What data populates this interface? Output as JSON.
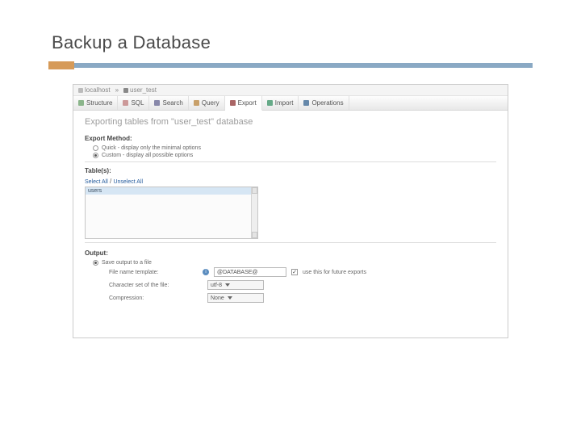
{
  "slide": {
    "title": "Backup a Database"
  },
  "breadcrumb": {
    "server": "localhost",
    "db": "user_test"
  },
  "tabs": {
    "structure": "Structure",
    "sql": "SQL",
    "search": "Search",
    "query": "Query",
    "export": "Export",
    "import": "Import",
    "operations": "Operations"
  },
  "page": {
    "heading": "Exporting tables from \"user_test\" database",
    "export_method_label": "Export Method:",
    "method_quick": "Quick - display only the minimal options",
    "method_custom": "Custom - display all possible options",
    "tables_label": "Table(s):",
    "select_all": "Select All",
    "unselect_all": "Unselect All",
    "table_items": [
      "users"
    ],
    "output_label": "Output:",
    "save_output": "Save output to a file",
    "filename_label": "File name template:",
    "filename_value": "@DATABASE@",
    "future_exports": "use this for future exports",
    "charset_label": "Character set of the file:",
    "charset_value": "utf-8",
    "compression_label": "Compression:",
    "compression_value": "None"
  }
}
